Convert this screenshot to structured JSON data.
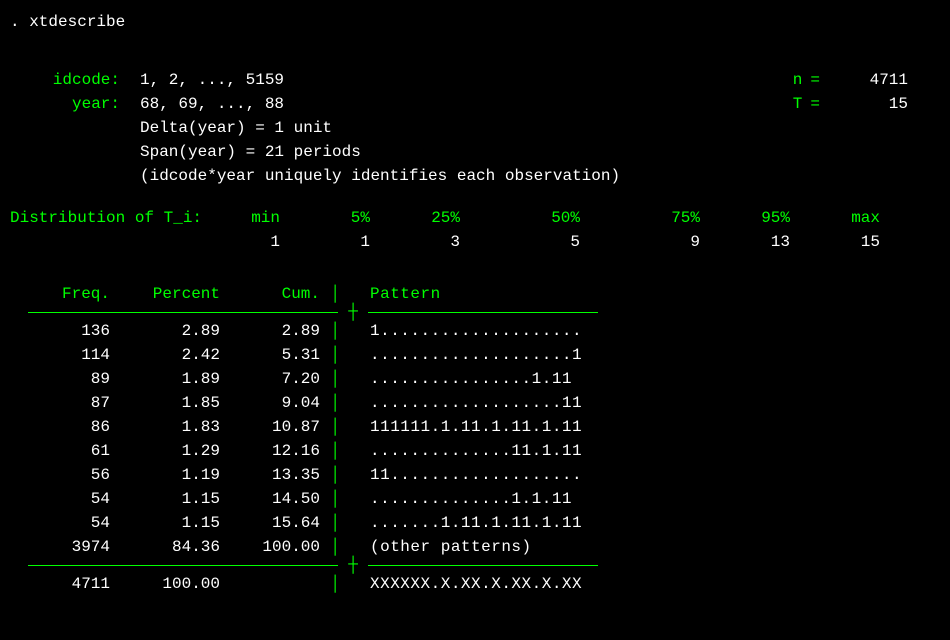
{
  "command": ". xtdescribe",
  "panel": {
    "idvar_label": "idcode:",
    "idvar_range": "1, 2, ..., 5159",
    "timevar_label": "year:",
    "timevar_range": "68, 69, ..., 88",
    "n_label": "n",
    "n_value": "4711",
    "T_label": "T",
    "T_value": "15",
    "delta": "Delta(year) = 1 unit",
    "span": "Span(year)  = 21 periods",
    "unique": "(idcode*year uniquely identifies each observation)"
  },
  "dist": {
    "label": "Distribution of T_i:",
    "headers": {
      "min": "min",
      "p5": "5%",
      "p25": "25%",
      "p50": "50%",
      "p75": "75%",
      "p95": "95%",
      "max": "max"
    },
    "values": {
      "min": "1",
      "p5": "1",
      "p25": "3",
      "p50": "5",
      "p75": "9",
      "p95": "13",
      "max": "15"
    }
  },
  "table": {
    "headers": {
      "freq": "Freq.",
      "pct": "Percent",
      "cum": "Cum.",
      "pattern": "Pattern"
    },
    "rows": [
      {
        "freq": "136",
        "pct": "2.89",
        "cum": "2.89",
        "pattern": "1...................."
      },
      {
        "freq": "114",
        "pct": "2.42",
        "cum": "5.31",
        "pattern": "....................1"
      },
      {
        "freq": "89",
        "pct": "1.89",
        "cum": "7.20",
        "pattern": "................1.11"
      },
      {
        "freq": "87",
        "pct": "1.85",
        "cum": "9.04",
        "pattern": "...................11"
      },
      {
        "freq": "86",
        "pct": "1.83",
        "cum": "10.87",
        "pattern": "111111.1.11.1.11.1.11"
      },
      {
        "freq": "61",
        "pct": "1.29",
        "cum": "12.16",
        "pattern": "..............11.1.11"
      },
      {
        "freq": "56",
        "pct": "1.19",
        "cum": "13.35",
        "pattern": "11..................."
      },
      {
        "freq": "54",
        "pct": "1.15",
        "cum": "14.50",
        "pattern": "..............1.1.11"
      },
      {
        "freq": "54",
        "pct": "1.15",
        "cum": "15.64",
        "pattern": ".......1.11.1.11.1.11"
      },
      {
        "freq": "3974",
        "pct": "84.36",
        "cum": "100.00",
        "pattern": "(other patterns)"
      }
    ],
    "total": {
      "freq": "4711",
      "pct": "100.00",
      "pattern": "XXXXXX.X.XX.X.XX.X.XX"
    }
  }
}
